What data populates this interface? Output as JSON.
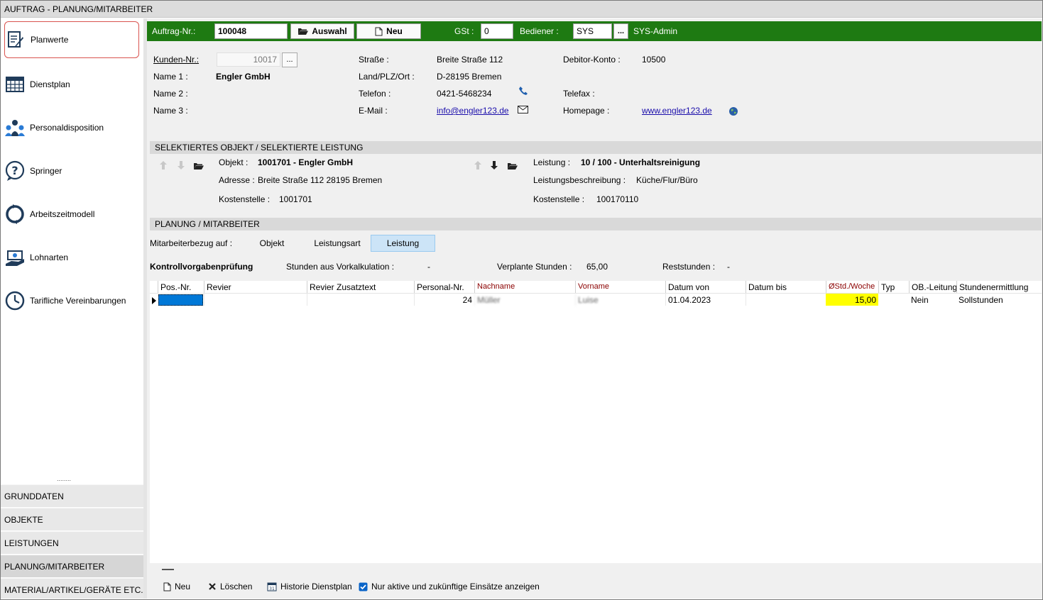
{
  "window": {
    "title": "AUFTRAG - PLANUNG/MITARBEITER"
  },
  "sidebar": {
    "items": [
      {
        "label": "Planwerte"
      },
      {
        "label": "Dienstplan"
      },
      {
        "label": "Personaldisposition"
      },
      {
        "label": "Springer"
      },
      {
        "label": "Arbeitszeitmodell"
      },
      {
        "label": "Lohnarten"
      },
      {
        "label": "Tarifliche Vereinbarungen"
      }
    ],
    "grip": "........",
    "sections": [
      {
        "label": "GRUNDDATEN"
      },
      {
        "label": "OBJEKTE"
      },
      {
        "label": "LEISTUNGEN"
      },
      {
        "label": "PLANUNG/MITARBEITER"
      },
      {
        "label": "MATERIAL/ARTIKEL/GERÄTE ETC."
      }
    ]
  },
  "header": {
    "auftrag_label": "Auftrag-Nr.:",
    "auftrag_value": "100048",
    "auswahl_label": "Auswahl",
    "neu_label": "Neu",
    "gst_label": "GSt :",
    "gst_value": "0",
    "bediener_label": "Bediener :",
    "bediener_value": "SYS",
    "browse_label": "...",
    "bediener_name": "SYS-Admin"
  },
  "customer": {
    "kunden_label": "Kunden-Nr.:",
    "kunden_value": "10017",
    "browse_label": "...",
    "name1_label": "Name 1 :",
    "name1_value": "Engler GmbH",
    "name2_label": "Name 2 :",
    "name3_label": "Name 3 :",
    "strasse_label": "Straße :",
    "strasse_value": "Breite Straße 112",
    "land_label": "Land/PLZ/Ort :",
    "land_value": "D-28195 Bremen",
    "telefon_label": "Telefon :",
    "telefon_value": "0421-5468234",
    "email_label": "E-Mail :",
    "email_value": "info@engler123.de",
    "debitor_label": "Debitor-Konto :",
    "debitor_value": "10500",
    "telefax_label": "Telefax :",
    "homepage_label": "Homepage :",
    "homepage_value": "www.engler123.de"
  },
  "selection": {
    "title": "SELEKTIERTES OBJEKT  / SELEKTIERTE LEISTUNG",
    "objekt_label": "Objekt :",
    "objekt_value": "1001701 - Engler GmbH",
    "adresse_label": "Adresse :",
    "adresse_value": "Breite Straße 112 28195 Bremen",
    "kostenstelle_label": "Kostenstelle :",
    "kostenstelle_value": "1001701",
    "leistung_label": "Leistung :",
    "leistung_value": "10 / 100 - Unterhaltsreinigung",
    "beschreibung_label": "Leistungsbeschreibung :",
    "beschreibung_value": "Küche/Flur/Büro",
    "l_kostenstelle_label": "Kostenstelle :",
    "l_kostenstelle_value": "100170110"
  },
  "planung": {
    "title": "PLANUNG / MITARBEITER",
    "bezug_label": "Mitarbeiterbezug auf :",
    "seg_objekt": "Objekt",
    "seg_leistungsart": "Leistungsart",
    "seg_leistung": "Leistung",
    "kontroll_label": "Kontrollvorgabenprüfung",
    "vorkalk_label": "Stunden aus Vorkalkulation :",
    "vorkalk_value": "-",
    "verplant_label": "Verplante Stunden :",
    "verplant_value": "65,00",
    "rest_label": "Reststunden :",
    "rest_value": "-"
  },
  "grid": {
    "columns": [
      "Pos.-Nr.",
      "Revier",
      "Revier Zusatztext",
      "Personal-Nr.",
      "Nachname",
      "Vorname",
      "Datum von",
      "Datum bis",
      "ØStd./Woche",
      "Typ",
      "OB.-Leitung",
      "Stundenermittlung"
    ],
    "row": {
      "pos": "",
      "revier": "",
      "zusatz": "",
      "personal": "24",
      "nachname": "Müller",
      "vorname": "Luise",
      "datum_von": "01.04.2023",
      "datum_bis": "",
      "std": "15,00",
      "typ": "",
      "ob": "Nein",
      "ermittlung": "Sollstunden"
    }
  },
  "toolbar": {
    "neu_label": "Neu",
    "loeschen_label": "Löschen",
    "historie_label": "Historie Dienstplan",
    "aktive_label": "Nur aktive und zukünftige Einsätze anzeigen"
  },
  "colors": {
    "green_bar": "#1e7a12",
    "highlight_yellow": "#ffff00",
    "selection_blue": "#0078d7",
    "segment_active": "#cce4f7"
  }
}
